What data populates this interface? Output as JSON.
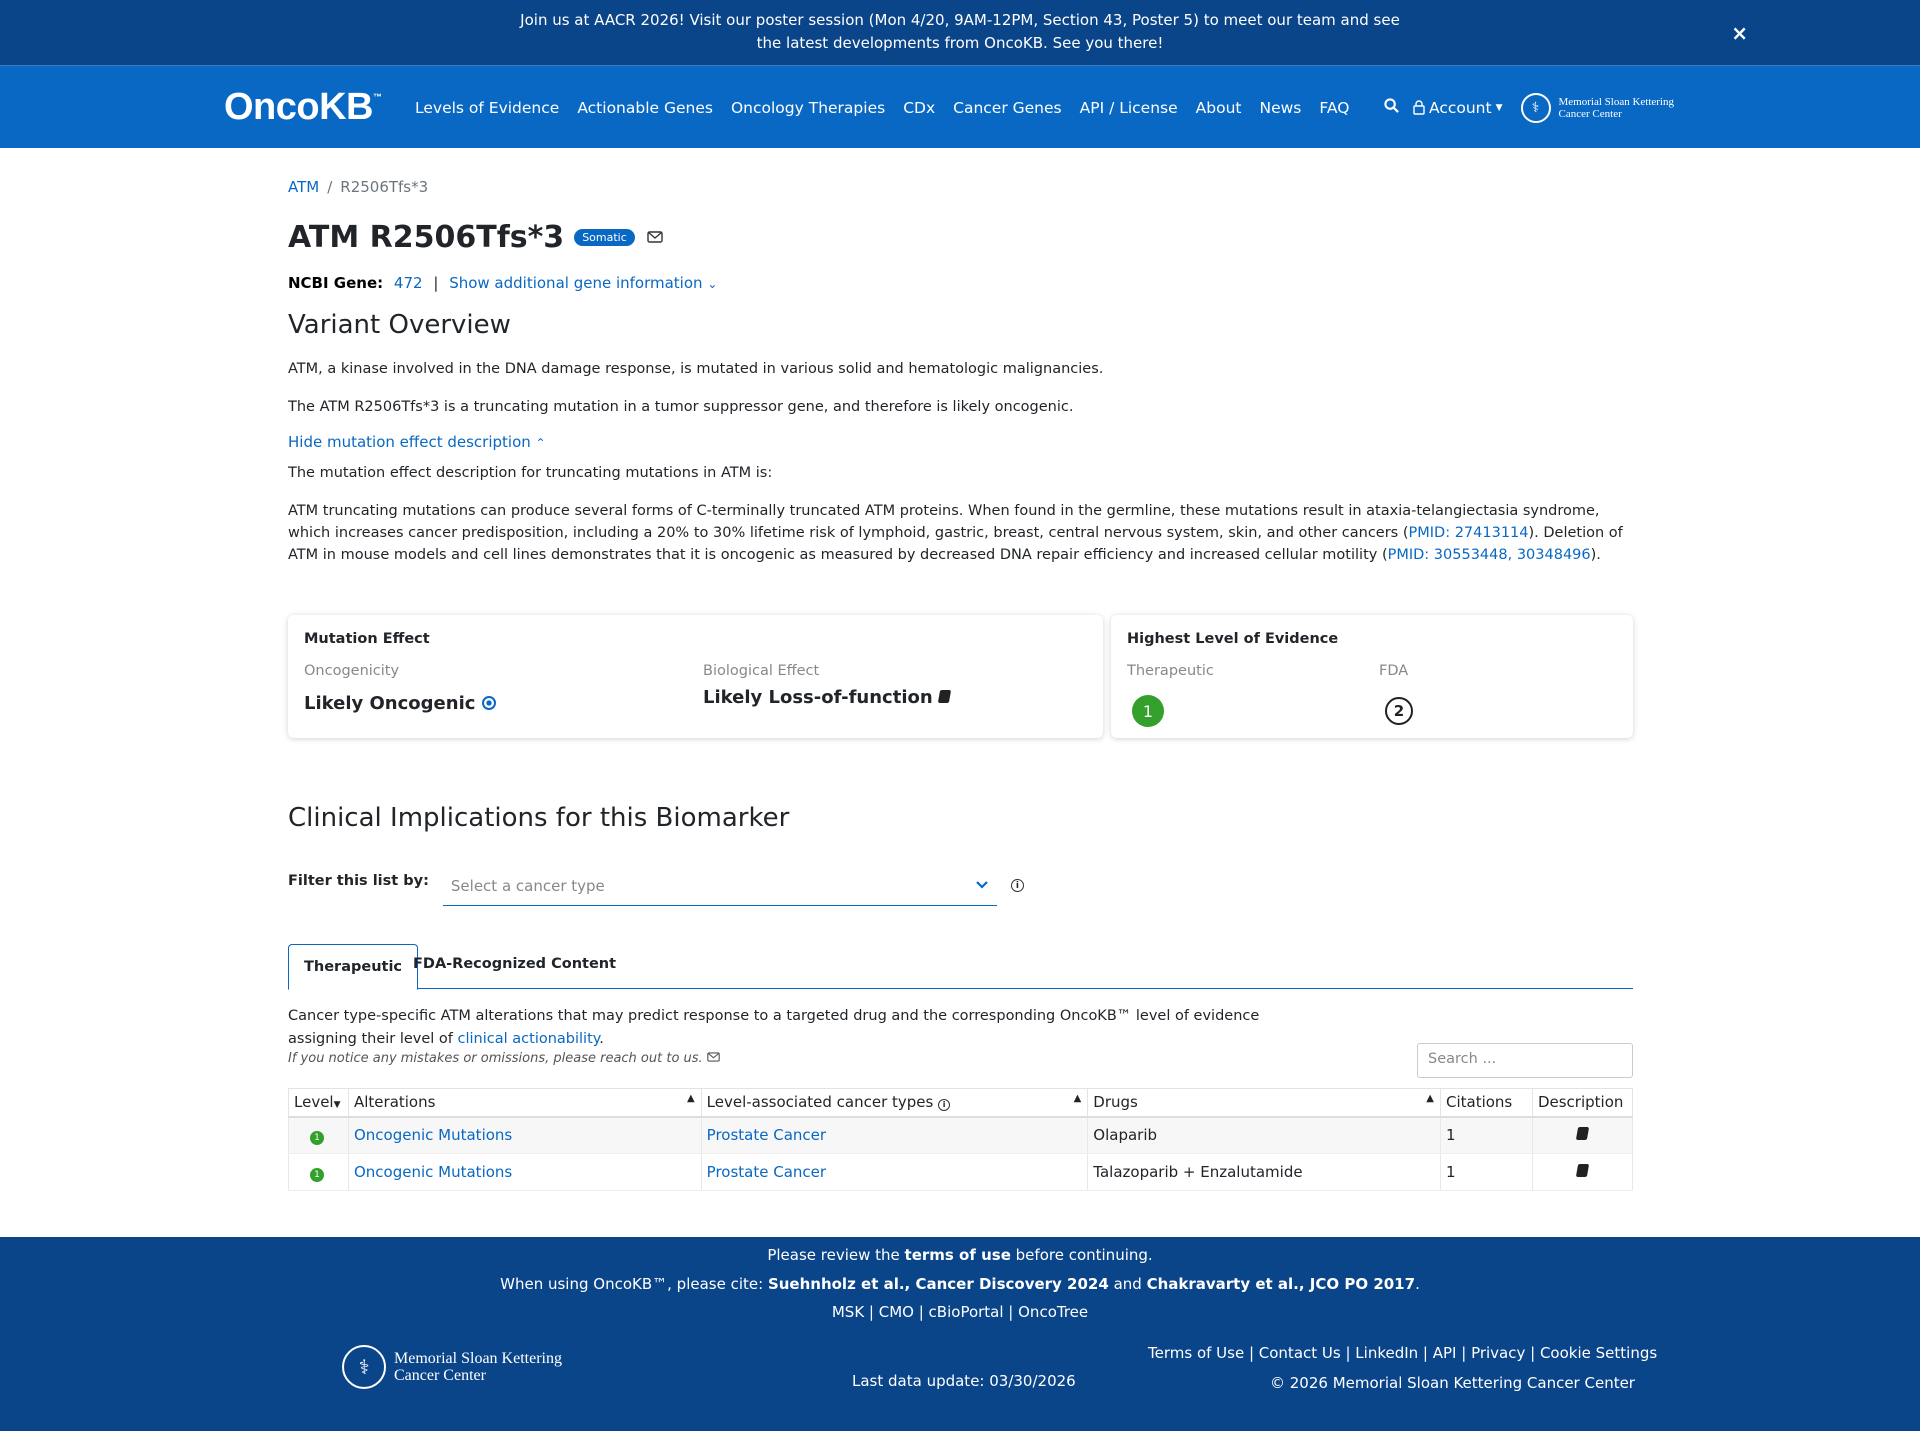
{
  "banner": {
    "message": "Join us at AACR 2026! Visit our poster session (Mon 4/20, 9AM-12PM, Section 43, Poster 5) to meet our team and see the latest developments from OncoKB. See you there!",
    "close": "×"
  },
  "nav": {
    "logo": "OncoKB",
    "logo_tm": "™",
    "links": [
      "Levels of Evidence",
      "Actionable Genes",
      "Oncology Therapies",
      "CDx",
      "Cancer Genes",
      "API / License",
      "About",
      "News",
      "FAQ"
    ],
    "account": "Account",
    "msk_line1": "Memorial Sloan Kettering",
    "msk_line2": "Cancer Center"
  },
  "breadcrumb": {
    "gene": "ATM",
    "sep": "/",
    "variant": "R2506Tfs*3"
  },
  "title": {
    "text": "ATM R2506Tfs*3",
    "badge": "Somatic"
  },
  "ncbi": {
    "label": "NCBI Gene:",
    "id": "472",
    "sep": "|",
    "more": "Show additional gene information"
  },
  "overview": {
    "heading": "Variant Overview",
    "p1": "ATM, a kinase involved in the DNA damage response, is mutated in various solid and hematologic malignancies.",
    "p2": "The ATM R2506Tfs*3 is a truncating mutation in a tumor suppressor gene, and therefore is likely oncogenic.",
    "hide_link": "Hide mutation effect description",
    "p3": "The mutation effect description for truncating mutations in ATM is:",
    "p4_a": "ATM truncating mutations can produce several forms of C-terminally truncated ATM proteins. When found in the germline, these mutations result in ataxia-telangiectasia syndrome, which increases cancer predisposition, including a 20% to 30% lifetime risk of lymphoid, gastric, breast, central nervous system, skin, and other cancers (",
    "p4_pmid1": "PMID: 27413114",
    "p4_b": "). Deletion of ATM in mouse models and cell lines demonstrates that it is oncogenic as measured by decreased DNA repair efficiency and increased cellular motility (",
    "p4_pmid2": "PMID: 30553448, 30348496",
    "p4_c": ")."
  },
  "mutation_effect": {
    "heading": "Mutation Effect",
    "onc_label": "Oncogenicity",
    "onc_value": "Likely Oncogenic",
    "bio_label": "Biological Effect",
    "bio_value": "Likely Loss-of-function"
  },
  "highest_level": {
    "heading": "Highest Level of Evidence",
    "ther_label": "Therapeutic",
    "ther_value": "1",
    "fda_label": "FDA",
    "fda_value": "2"
  },
  "clinical": {
    "heading": "Clinical Implications for this Biomarker",
    "filter_label": "Filter this list by:",
    "filter_placeholder": "Select a cancer type",
    "tabs": [
      "Therapeutic",
      "FDA-Recognized Content"
    ],
    "desc_a": "Cancer type-specific ATM alterations that may predict response to a targeted drug and the corresponding OncoKB™ level of evidence assigning their level of ",
    "desc_link": "clinical actionability",
    "desc_b": ".",
    "note": "If you notice any mistakes or omissions, please reach out to us.",
    "search_placeholder": "Search ...",
    "columns": [
      "Level",
      "Alterations",
      "Level-associated cancer types",
      "Drugs",
      "Citations",
      "Description"
    ],
    "rows": [
      {
        "level": "1",
        "alteration": "Oncogenic Mutations",
        "cancer": "Prostate Cancer",
        "drugs": "Olaparib",
        "citations": "1"
      },
      {
        "level": "1",
        "alteration": "Oncogenic Mutations",
        "cancer": "Prostate Cancer",
        "drugs": "Talazoparib + Enzalutamide",
        "citations": "1"
      }
    ]
  },
  "footer": {
    "review_a": "Please review the ",
    "review_link": "terms of use",
    "review_b": " before continuing.",
    "cite_a": "When using OncoKB™, please cite: ",
    "cite_b1": "Suehnholz et al., Cancer Discovery 2024",
    "cite_and": " and ",
    "cite_b2": "Chakravarty et al., JCO PO 2017",
    "cite_end": ".",
    "partners": "MSK | CMO | cBioPortal | OncoTree",
    "msk_line1": "Memorial Sloan Kettering",
    "msk_line2": "Cancer Center",
    "last_update": "Last data update: 03/30/2026",
    "links": "Terms of Use | Contact Us | LinkedIn | API | Privacy | Cookie Settings",
    "copyright": "© 2026 Memorial Sloan Kettering Cancer Center"
  },
  "colors": {
    "brand": "#0968c3",
    "banner": "#0a4489",
    "level1": "#33a02c"
  }
}
